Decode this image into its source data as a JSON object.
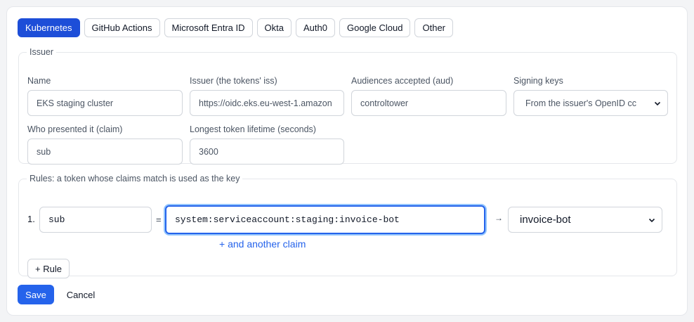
{
  "tabs": [
    {
      "label": "Kubernetes",
      "active": true
    },
    {
      "label": "GitHub Actions",
      "active": false
    },
    {
      "label": "Microsoft Entra ID",
      "active": false
    },
    {
      "label": "Okta",
      "active": false
    },
    {
      "label": "Auth0",
      "active": false
    },
    {
      "label": "Google Cloud",
      "active": false
    },
    {
      "label": "Other",
      "active": false
    }
  ],
  "issuer": {
    "legend": "Issuer",
    "name": {
      "label": "Name",
      "value": "EKS staging cluster"
    },
    "iss": {
      "label": "Issuer (the tokens' iss)",
      "value": "https://oidc.eks.eu-west-1.amazon"
    },
    "aud": {
      "label": "Audiences accepted (aud)",
      "value": "controltower"
    },
    "signing": {
      "label": "Signing keys",
      "value": "From the issuer's OpenID cc"
    },
    "claim": {
      "label": "Who presented it (claim)",
      "value": "sub"
    },
    "lifetime": {
      "label": "Longest token lifetime (seconds)",
      "value": "3600"
    }
  },
  "rules": {
    "legend": "Rules: a token whose claims match is used as the key",
    "items": [
      {
        "number": "1.",
        "claim": "sub",
        "equals": "=",
        "value": "system:serviceaccount:staging:invoice-bot",
        "arrow": "→",
        "key": "invoice-bot",
        "add_claim": "+ and another claim"
      }
    ],
    "add_rule": "+ Rule"
  },
  "actions": {
    "save": "Save",
    "cancel": "Cancel"
  },
  "colors": {
    "accent": "#2563eb",
    "tab_active": "#1d4ed8",
    "focus_ring": "#93c5fd"
  }
}
